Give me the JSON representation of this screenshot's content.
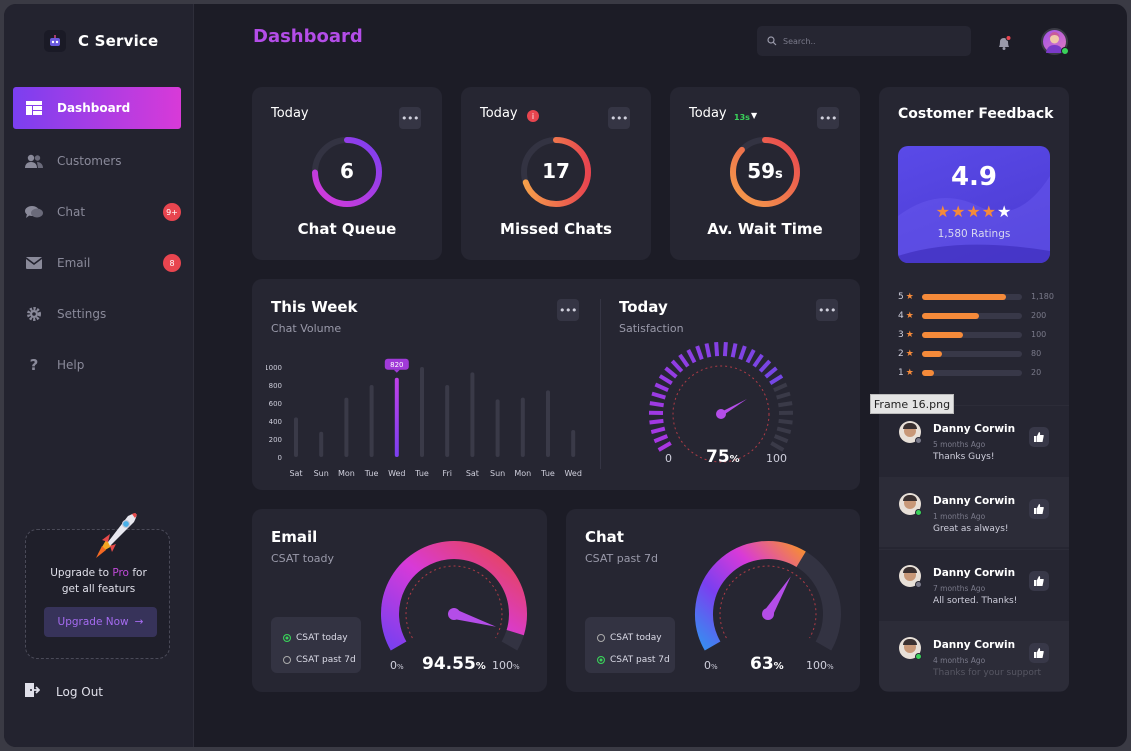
{
  "brand": {
    "name": "C Service"
  },
  "sidebar": {
    "items": [
      {
        "label": "Dashboard"
      },
      {
        "label": "Customers"
      },
      {
        "label": "Chat",
        "badge": "9+"
      },
      {
        "label": "Email",
        "badge": "8"
      },
      {
        "label": "Settings"
      },
      {
        "label": "Help"
      }
    ],
    "upgrade": {
      "text_before": "Upgrade to ",
      "text_pro": "Pro",
      "text_after": " for",
      "text_line2": "get all featurs",
      "button": "Upgrade Now"
    },
    "logout": "Log Out"
  },
  "header": {
    "title": "Dashboard",
    "search_placeholder": "Search.."
  },
  "stats": [
    {
      "period": "Today",
      "value": "6",
      "label": "Chat Queue"
    },
    {
      "period": "Today",
      "value": "17",
      "label": "Missed Chats"
    },
    {
      "period": "Today",
      "trend": "13s",
      "value": "59",
      "unit": "s",
      "label": "Av. Wait Time"
    }
  ],
  "week_card": {
    "title": "This Week",
    "subtitle": "Chat Volume"
  },
  "satisfaction_card": {
    "title": "Today",
    "subtitle": "Satisfaction",
    "value": "75",
    "unit": "%",
    "min": "0",
    "max": "100"
  },
  "email_card": {
    "title": "Email",
    "subtitle": "CSAT toady",
    "value": "94.55",
    "unit": "%",
    "min": "0",
    "min_unit": "%",
    "max": "100",
    "max_unit": "%",
    "legend": [
      "CSAT today",
      "CSAT past 7d"
    ]
  },
  "chat_card": {
    "title": "Chat",
    "subtitle": "CSAT past 7d",
    "value": "63",
    "unit": "%",
    "min": "0",
    "min_unit": "%",
    "max": "100",
    "max_unit": "%",
    "legend": [
      "CSAT today",
      "CSAT past 7d"
    ]
  },
  "chart_data": [
    {
      "type": "bar",
      "title": "Chat Volume",
      "categories": [
        "Sat",
        "Sun",
        "Mon",
        "Tue",
        "Wed",
        "Tue",
        "Fri",
        "Sat",
        "Sun",
        "Mon",
        "Tue",
        "Wed"
      ],
      "values": [
        440,
        280,
        660,
        800,
        880,
        1000,
        800,
        940,
        640,
        660,
        740,
        300
      ],
      "highlight_index": 4,
      "highlight_label": "820",
      "yticks": [
        "0",
        "200",
        "400",
        "600",
        "800",
        "1000"
      ],
      "ylim": [
        0,
        1000
      ]
    }
  ],
  "colors": {
    "accent": "#b44de8",
    "orange": "#f58a3a",
    "purple": "#7b3ff0",
    "pink": "#d83ad8"
  },
  "feedback": {
    "title": "Costomer Feedback",
    "score": "4.9",
    "ratings": "1,580 Ratings",
    "bars": [
      {
        "star": "5",
        "count": "1,180",
        "fraction": 0.84
      },
      {
        "star": "4",
        "count": "200",
        "fraction": 0.57
      },
      {
        "star": "3",
        "count": "100",
        "fraction": 0.41
      },
      {
        "star": "2",
        "count": "80",
        "fraction": 0.2
      },
      {
        "star": "1",
        "count": "20",
        "fraction": 0.12
      }
    ],
    "reviews": [
      {
        "name": "Danny Corwin",
        "time": "5 months Ago",
        "message": "Thanks Guys!",
        "status": "#7a7a8a"
      },
      {
        "name": "Danny Corwin",
        "time": "1 months Ago",
        "message": "Great as always!",
        "status": "#3ad25a"
      },
      {
        "name": "Danny Corwin",
        "time": "7 months Ago",
        "message": "All sorted. Thanks!",
        "status": "#7a7a8a"
      },
      {
        "name": "Danny Corwin",
        "time": "4 months Ago",
        "message": "Thanks for your support",
        "status": "#3ad25a"
      }
    ]
  },
  "tooltip": "Frame 16.png"
}
